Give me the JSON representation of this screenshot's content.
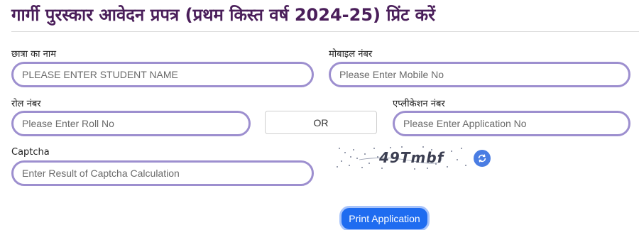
{
  "page": {
    "title": "गार्गी पुरस्कार आवेदन प्रपत्र (प्रथम किस्त वर्ष 2024-25) प्रिंट करें"
  },
  "form": {
    "student_name": {
      "label": "छात्रा का नाम",
      "placeholder": "PLEASE ENTER STUDENT NAME",
      "value": ""
    },
    "mobile": {
      "label": "मोबाइल नंबर",
      "placeholder": "Please Enter Mobile No",
      "value": ""
    },
    "roll_no": {
      "label": "रोल नंबर",
      "placeholder": "Please Enter Roll No",
      "value": ""
    },
    "or_label": "OR",
    "application_no": {
      "label": "एप्लीकेशन नंबर",
      "placeholder": "Please Enter Application No",
      "value": ""
    },
    "captcha": {
      "label": "Captcha",
      "placeholder": "Enter Result of Captcha Calculation",
      "value": "",
      "image_text": "49Tmbf",
      "refresh_icon": "refresh-icon"
    },
    "submit_label": "Print Application"
  },
  "colors": {
    "title": "#4a1e5a",
    "input_border": "#9d8fcf",
    "button": "#1f6cf0",
    "refresh": "#4a7de3"
  }
}
